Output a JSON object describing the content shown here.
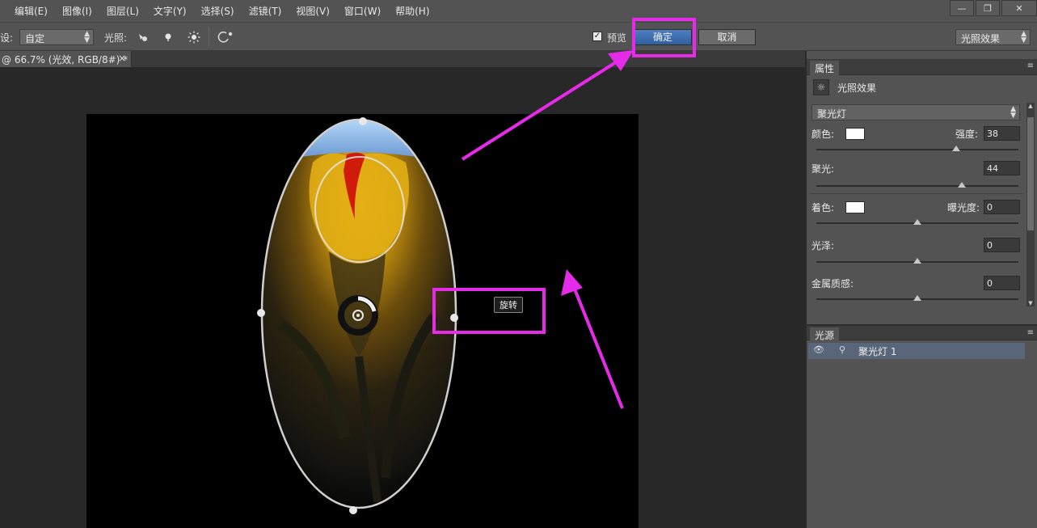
{
  "menubar": {
    "items": [
      "",
      "编辑(E)",
      "图像(I)",
      "图层(L)",
      "文字(Y)",
      "选择(S)",
      "滤镜(T)",
      "视图(V)",
      "窗口(W)",
      "帮助(H)"
    ],
    "window_controls": [
      "—",
      "❐",
      "✕"
    ]
  },
  "options": {
    "preset_label": "设:",
    "preset_value": "自定",
    "light_label": "光照:",
    "preview_label": "预览",
    "preview_checked": true,
    "ok_label": "确定",
    "cancel_label": "取消",
    "workspace_value": "光照效果"
  },
  "document": {
    "tab_title": "@ 66.7% (光效, RGB/8#) *",
    "close": "×"
  },
  "canvas": {
    "tooltip": "旋转"
  },
  "properties": {
    "tab": "属性",
    "title": "光照效果",
    "light_type": "聚光灯",
    "color_label": "颜色:",
    "intensity_label": "强度:",
    "intensity_value": "38",
    "intensity_level": 0.69,
    "hotspot_label": "聚光:",
    "hotspot_value": "44",
    "hotspot_level": 0.72,
    "colorize_label": "着色:",
    "exposure_label": "曝光度:",
    "exposure_value": "0",
    "exposure_level": 0.5,
    "gloss_label": "光泽:",
    "gloss_value": "0",
    "gloss_level": 0.5,
    "metallic_label": "金属质感:",
    "metallic_value": "0",
    "metallic_level": 0.5
  },
  "lights": {
    "tab": "光源",
    "items": [
      "聚光灯 1"
    ]
  },
  "colors": {
    "highlight": "#e52be8",
    "ok_button": "#3a6aad",
    "selected_row": "#59667a"
  }
}
